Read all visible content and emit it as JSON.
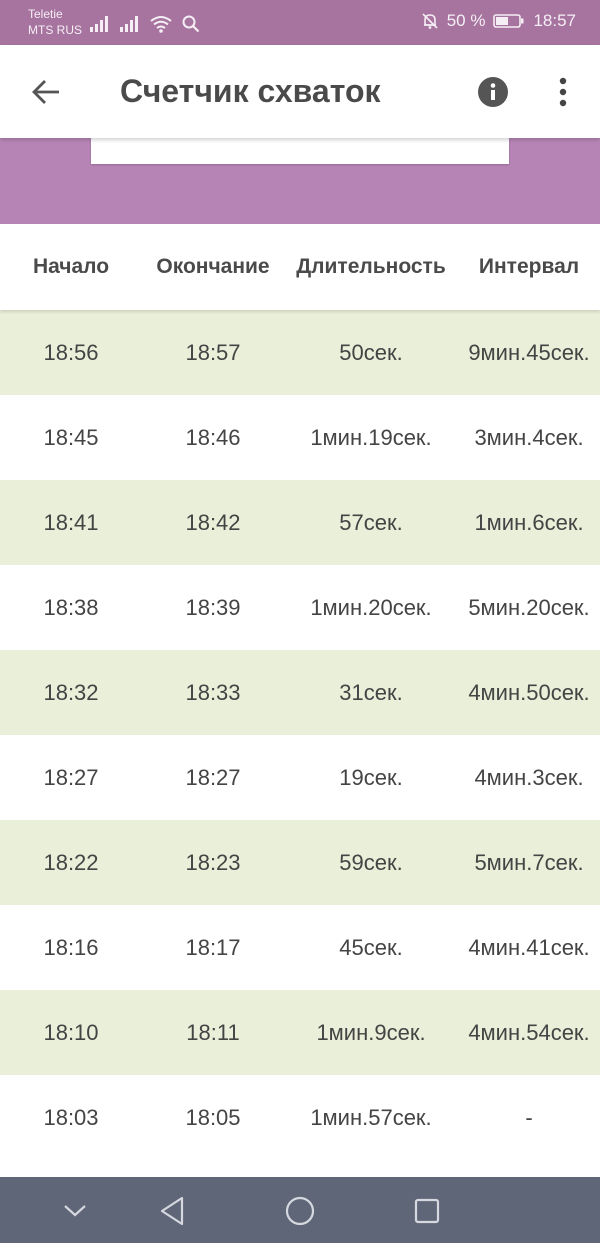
{
  "status_bar": {
    "carrier_line1": "Teletie",
    "carrier_line2": "MTS RUS",
    "battery_percent": "50 %",
    "time": "18:57"
  },
  "app_bar": {
    "title": "Счетчик схваток"
  },
  "table": {
    "headers": {
      "start": "Начало",
      "end": "Окончание",
      "duration": "Длительность",
      "interval": "Интервал"
    },
    "rows": [
      {
        "start": "18:56",
        "end": "18:57",
        "duration": "50сек.",
        "interval": "9мин.45сек."
      },
      {
        "start": "18:45",
        "end": "18:46",
        "duration": "1мин.19сек.",
        "interval": "3мин.4сек."
      },
      {
        "start": "18:41",
        "end": "18:42",
        "duration": "57сек.",
        "interval": "1мин.6сек."
      },
      {
        "start": "18:38",
        "end": "18:39",
        "duration": "1мин.20сек.",
        "interval": "5мин.20сек."
      },
      {
        "start": "18:32",
        "end": "18:33",
        "duration": "31сек.",
        "interval": "4мин.50сек."
      },
      {
        "start": "18:27",
        "end": "18:27",
        "duration": "19сек.",
        "interval": "4мин.3сек."
      },
      {
        "start": "18:22",
        "end": "18:23",
        "duration": "59сек.",
        "interval": "5мин.7сек."
      },
      {
        "start": "18:16",
        "end": "18:17",
        "duration": "45сек.",
        "interval": "4мин.41сек."
      },
      {
        "start": "18:10",
        "end": "18:11",
        "duration": "1мин.9сек.",
        "interval": "4мин.54сек."
      },
      {
        "start": "18:03",
        "end": "18:05",
        "duration": "1мин.57сек.",
        "interval": "-"
      }
    ]
  },
  "colors": {
    "status_bar": "#a6749f",
    "purple_band": "#b785b5",
    "row_alt": "#eaefd9",
    "nav_bar": "#5f6677"
  },
  "icons": {
    "back": "arrow-left-icon",
    "info": "info-icon",
    "more": "more-vert-icon",
    "nav_down": "chevron-down-icon",
    "nav_back": "triangle-back-icon",
    "nav_home": "circle-home-icon",
    "nav_recents": "square-recents-icon"
  }
}
